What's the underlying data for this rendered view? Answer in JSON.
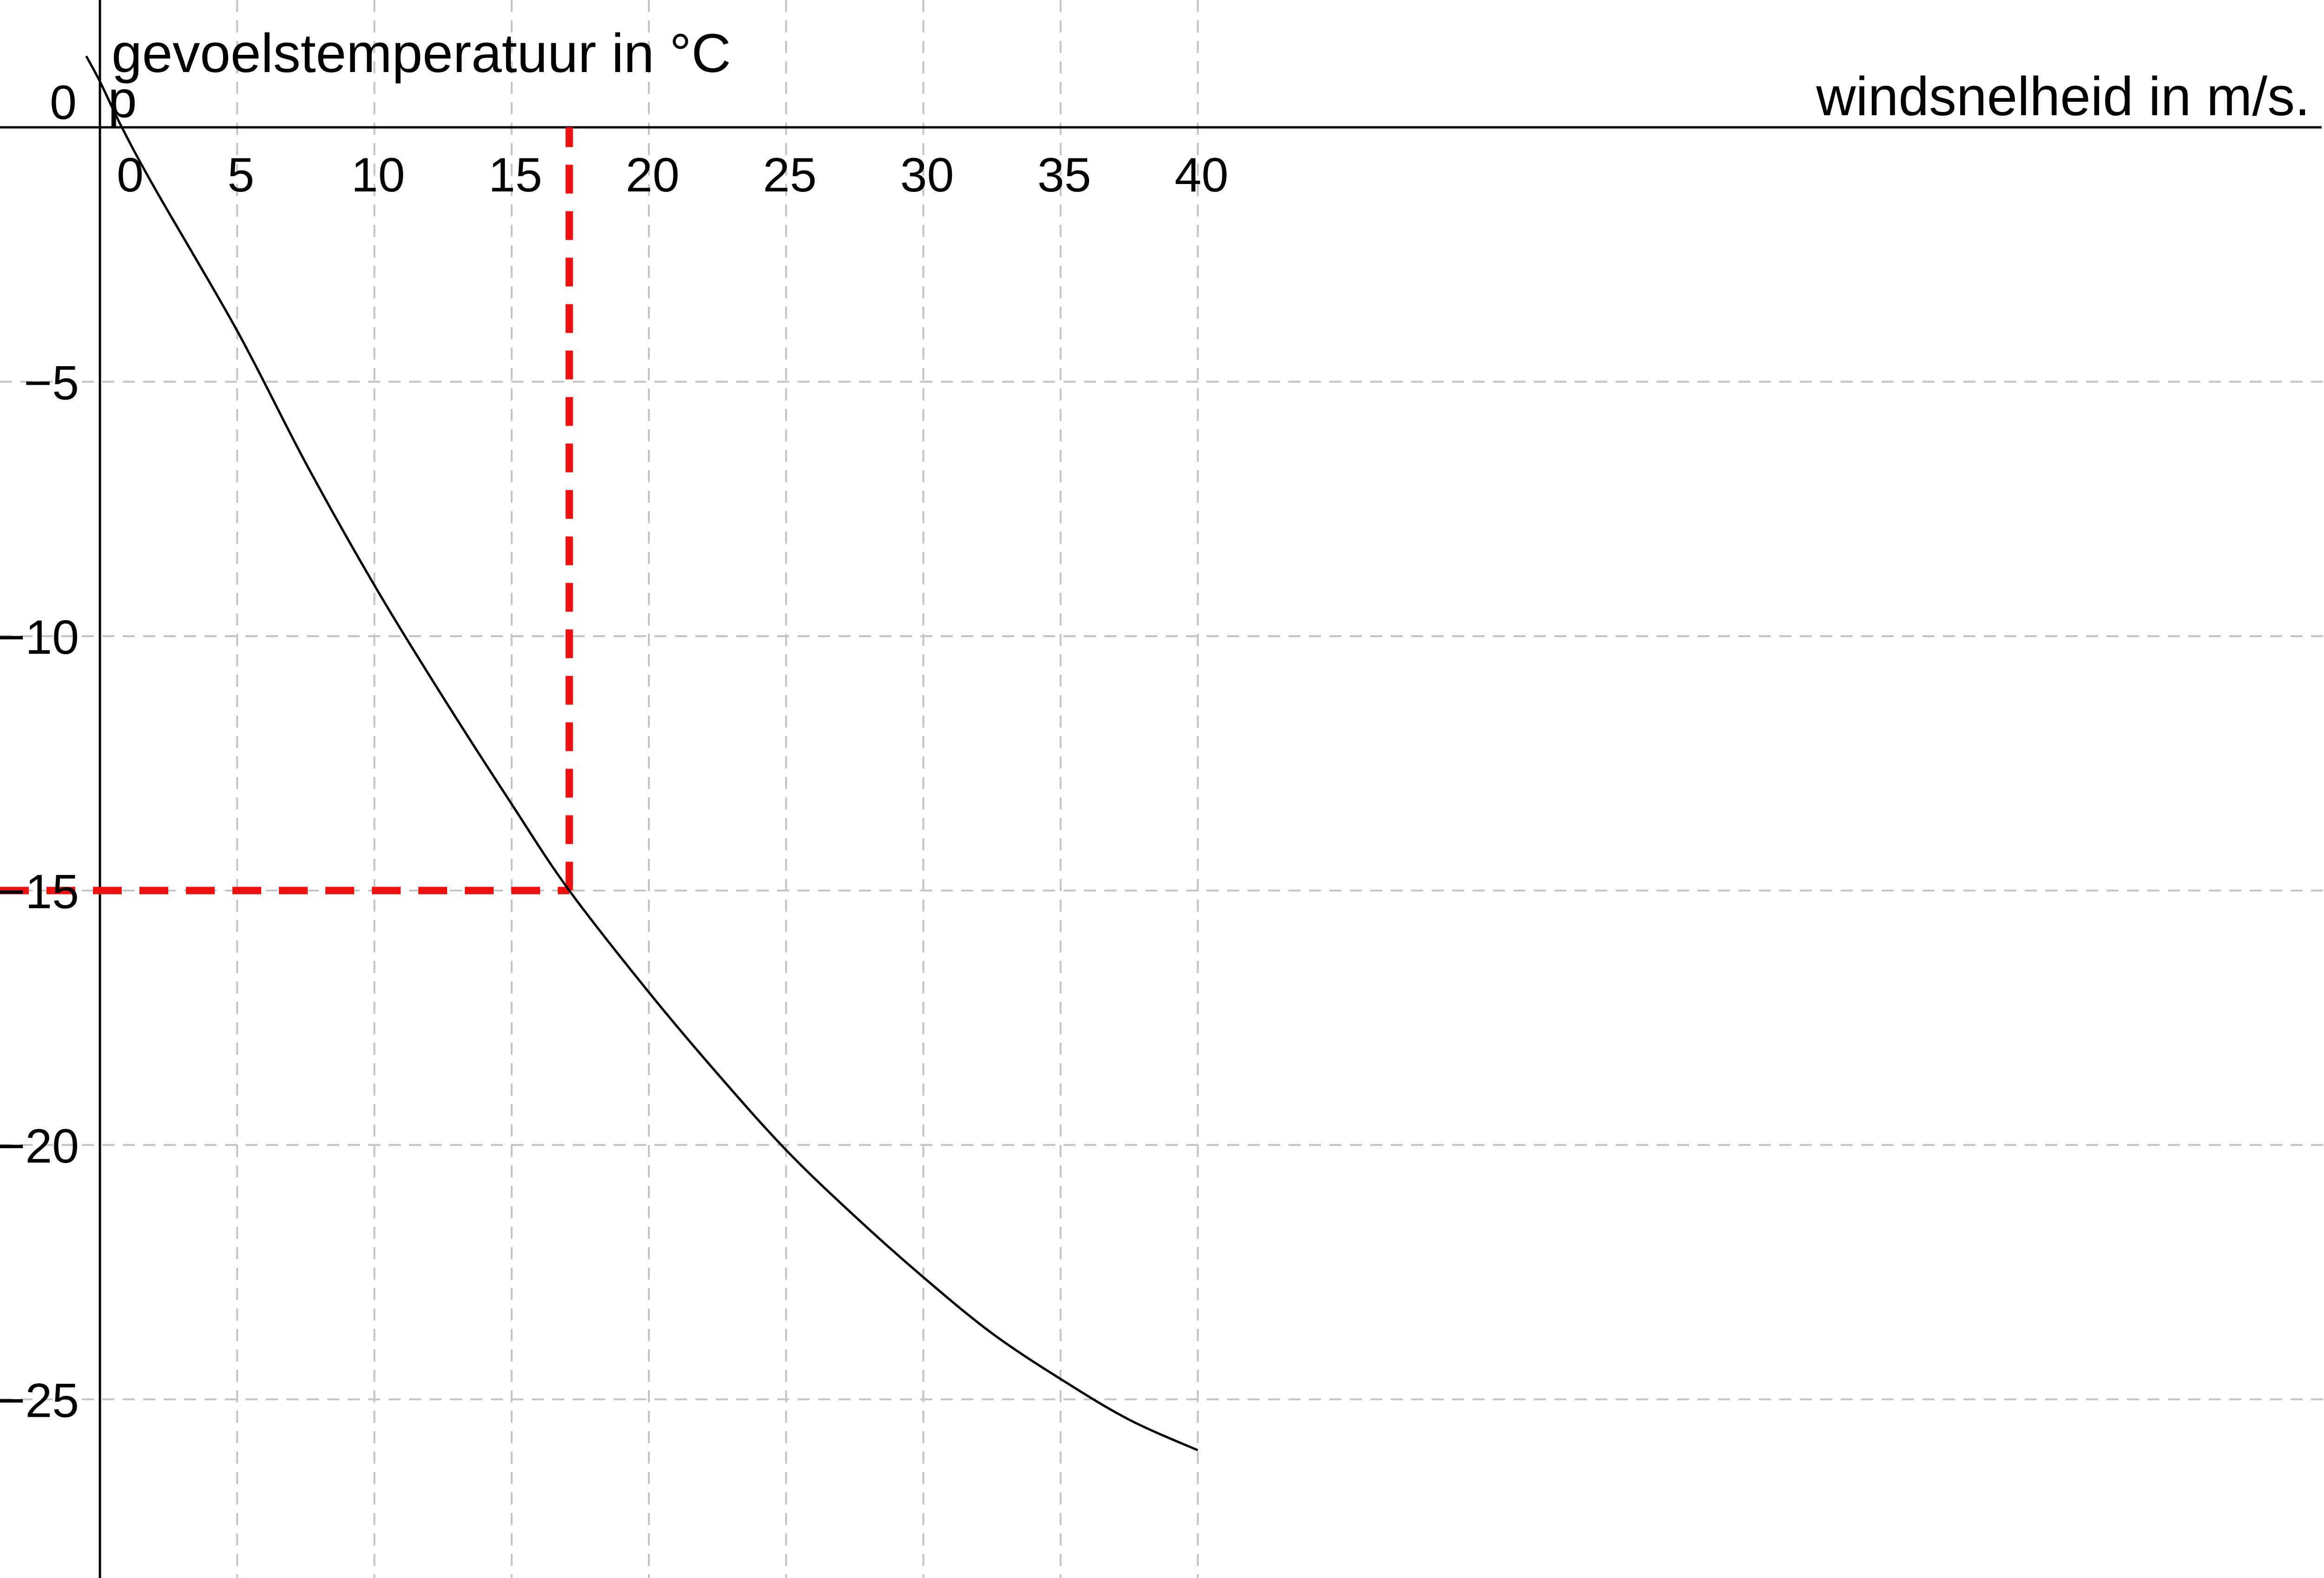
{
  "chart_data": {
    "type": "line",
    "xlabel": "windsnelheid in m/s.",
    "ylabel": "gevoelstemperatuur in °C",
    "xlim": [
      -0.5,
      40.7
    ],
    "ylim": [
      -28,
      2.5
    ],
    "grid": true,
    "x_ticks": [
      "0",
      "5",
      "10",
      "15",
      "20",
      "25",
      "30",
      "35",
      "40"
    ],
    "y_ticks": [
      "0",
      "−5",
      "−10",
      "−15",
      "−20",
      "−25"
    ],
    "series": [
      {
        "x": [
          -0.5,
          0,
          0.8,
          2,
          5,
          7.5,
          10,
          12.5,
          15,
          17.1,
          20,
          22.5,
          25,
          27.5,
          30,
          32.5,
          35,
          37.5,
          40
        ],
        "y": [
          1.4,
          0.9,
          0,
          -1.2,
          -4.0,
          -6.6,
          -9.0,
          -11.2,
          -13.3,
          -15.0,
          -17.0,
          -18.6,
          -20.1,
          -21.4,
          -22.6,
          -23.7,
          -24.6,
          -25.4,
          -26.0
        ]
      }
    ],
    "annotations": [
      {
        "label": "p",
        "x": 0.8,
        "y": 0
      }
    ],
    "reference_lines": [
      {
        "color": "#ee1111",
        "style": "dashed",
        "from": [
          -0.5,
          -15
        ],
        "to": [
          17.1,
          -15
        ]
      },
      {
        "color": "#ee1111",
        "style": "dashed",
        "from": [
          17.1,
          -15
        ],
        "to": [
          17.1,
          0
        ]
      }
    ]
  }
}
